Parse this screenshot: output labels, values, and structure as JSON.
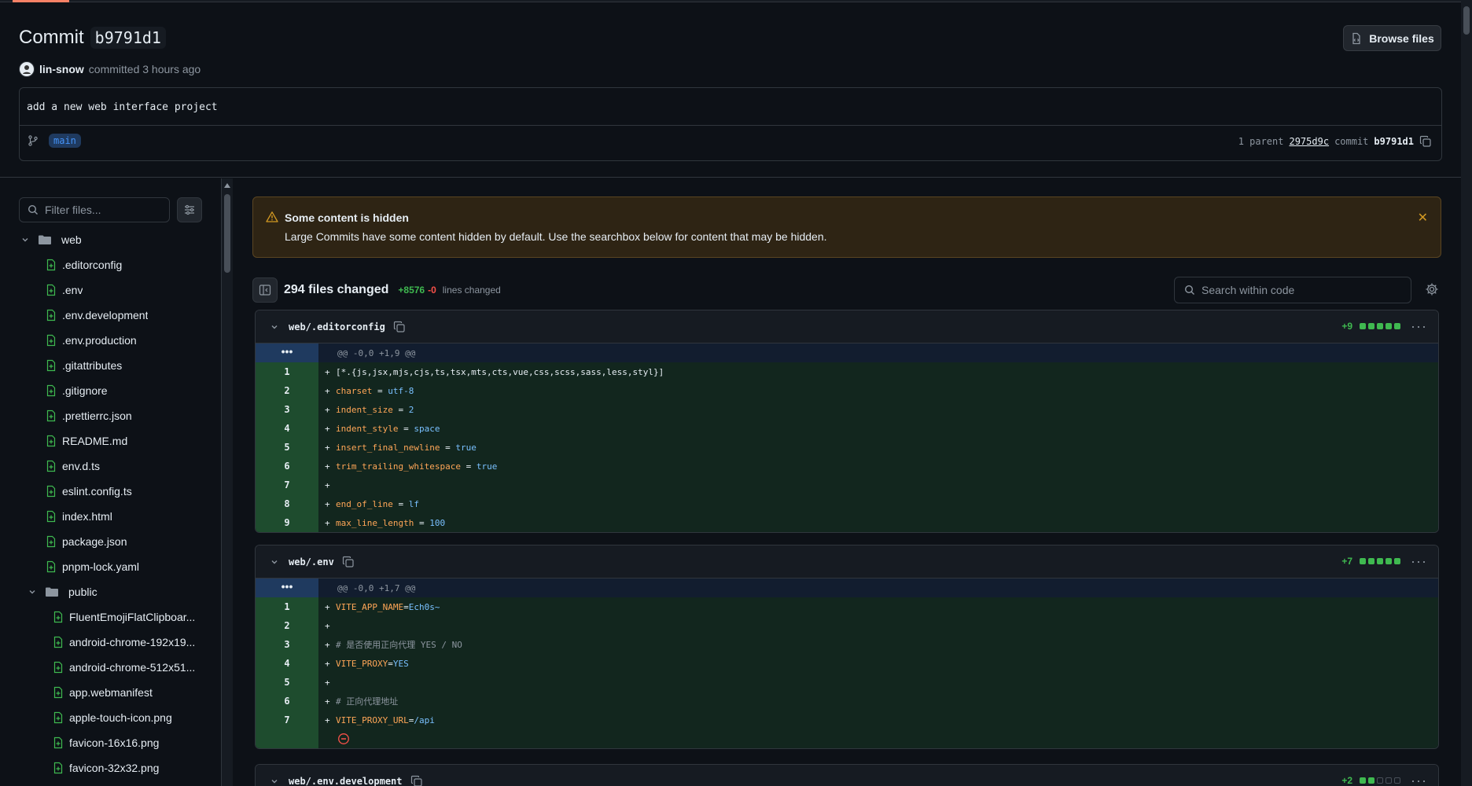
{
  "commit": {
    "title_label": "Commit",
    "sha": "b9791d1",
    "browse_label": "Browse files",
    "author": "lin-snow",
    "committed_text": "committed 3 hours ago",
    "message": "add a new web interface project",
    "branch": "main",
    "parent_count_text": "1 parent",
    "parent_sha": "2975d9c",
    "commit_label": "commit",
    "commit_sha": "b9791d1"
  },
  "sidebar": {
    "filter_placeholder": "Filter files...",
    "root_folder": "web",
    "files": [
      ".editorconfig",
      ".env",
      ".env.development",
      ".env.production",
      ".gitattributes",
      ".gitignore",
      ".prettierrc.json",
      "README.md",
      "env.d.ts",
      "eslint.config.ts",
      "index.html",
      "package.json",
      "pnpm-lock.yaml"
    ],
    "sub_folder": "public",
    "sub_files": [
      "FluentEmojiFlatClipboar...",
      "android-chrome-192x19...",
      "android-chrome-512x51...",
      "app.webmanifest",
      "apple-touch-icon.png",
      "favicon-16x16.png",
      "favicon-32x32.png"
    ]
  },
  "banner": {
    "title": "Some content is hidden",
    "text": "Large Commits have some content hidden by default. Use the searchbox below for content that may be hidden."
  },
  "summary": {
    "files_changed": "294 files changed",
    "additions": "+8576",
    "deletions": "-0",
    "lines_label": "lines changed",
    "search_placeholder": "Search within code"
  },
  "diffs": [
    {
      "filename": "web/.editorconfig",
      "stat": "+9",
      "stat_boxes": [
        "green",
        "green",
        "green",
        "green",
        "green"
      ],
      "hunk_marker": "•••",
      "hunk": "@@ -0,0 +1,9 @@",
      "lines": [
        {
          "n": "1",
          "plus": "+",
          "code": "[*.{js,jsx,mjs,cjs,ts,tsx,mts,cts,vue,css,scss,sass,less,styl}]"
        },
        {
          "n": "2",
          "plus": "+",
          "key": "charset",
          "eq": " = ",
          "val": "utf-8"
        },
        {
          "n": "3",
          "plus": "+",
          "key": "indent_size",
          "eq": " = ",
          "val": "2"
        },
        {
          "n": "4",
          "plus": "+",
          "key": "indent_style",
          "eq": " = ",
          "val": "space"
        },
        {
          "n": "5",
          "plus": "+",
          "key": "insert_final_newline",
          "eq": " = ",
          "val": "true"
        },
        {
          "n": "6",
          "plus": "+",
          "key": "trim_trailing_whitespace",
          "eq": " = ",
          "val": "true"
        },
        {
          "n": "7",
          "plus": "+",
          "code": ""
        },
        {
          "n": "8",
          "plus": "+",
          "key": "end_of_line",
          "eq": " = ",
          "val": "lf"
        },
        {
          "n": "9",
          "plus": "+",
          "key": "max_line_length",
          "eq": " = ",
          "val": "100"
        }
      ]
    },
    {
      "filename": "web/.env",
      "stat": "+7",
      "stat_boxes": [
        "green",
        "green",
        "green",
        "green",
        "green"
      ],
      "hunk_marker": "•••",
      "hunk": "@@ -0,0 +1,7 @@",
      "lines": [
        {
          "n": "1",
          "plus": "+",
          "key": "VITE_APP_NAME",
          "eq": "=",
          "val": "Ech0s~"
        },
        {
          "n": "2",
          "plus": "+",
          "code": ""
        },
        {
          "n": "3",
          "plus": "+",
          "comment": "# 是否使用正向代理 YES / NO"
        },
        {
          "n": "4",
          "plus": "+",
          "key": "VITE_PROXY",
          "eq": "=",
          "val": "YES"
        },
        {
          "n": "5",
          "plus": "+",
          "code": ""
        },
        {
          "n": "6",
          "plus": "+",
          "comment": "# 正向代理地址"
        },
        {
          "n": "7",
          "plus": "+",
          "key": "VITE_PROXY_URL",
          "eq": "=",
          "val": "/api"
        }
      ]
    },
    {
      "filename": "web/.env.development",
      "stat": "+2",
      "stat_boxes": [
        "green",
        "green",
        "gray",
        "gray",
        "gray"
      ]
    }
  ],
  "colors": {
    "accent_green": "#3fb950",
    "accent_red": "#f85149",
    "warning": "#d29922",
    "link_blue": "#4493f8"
  }
}
